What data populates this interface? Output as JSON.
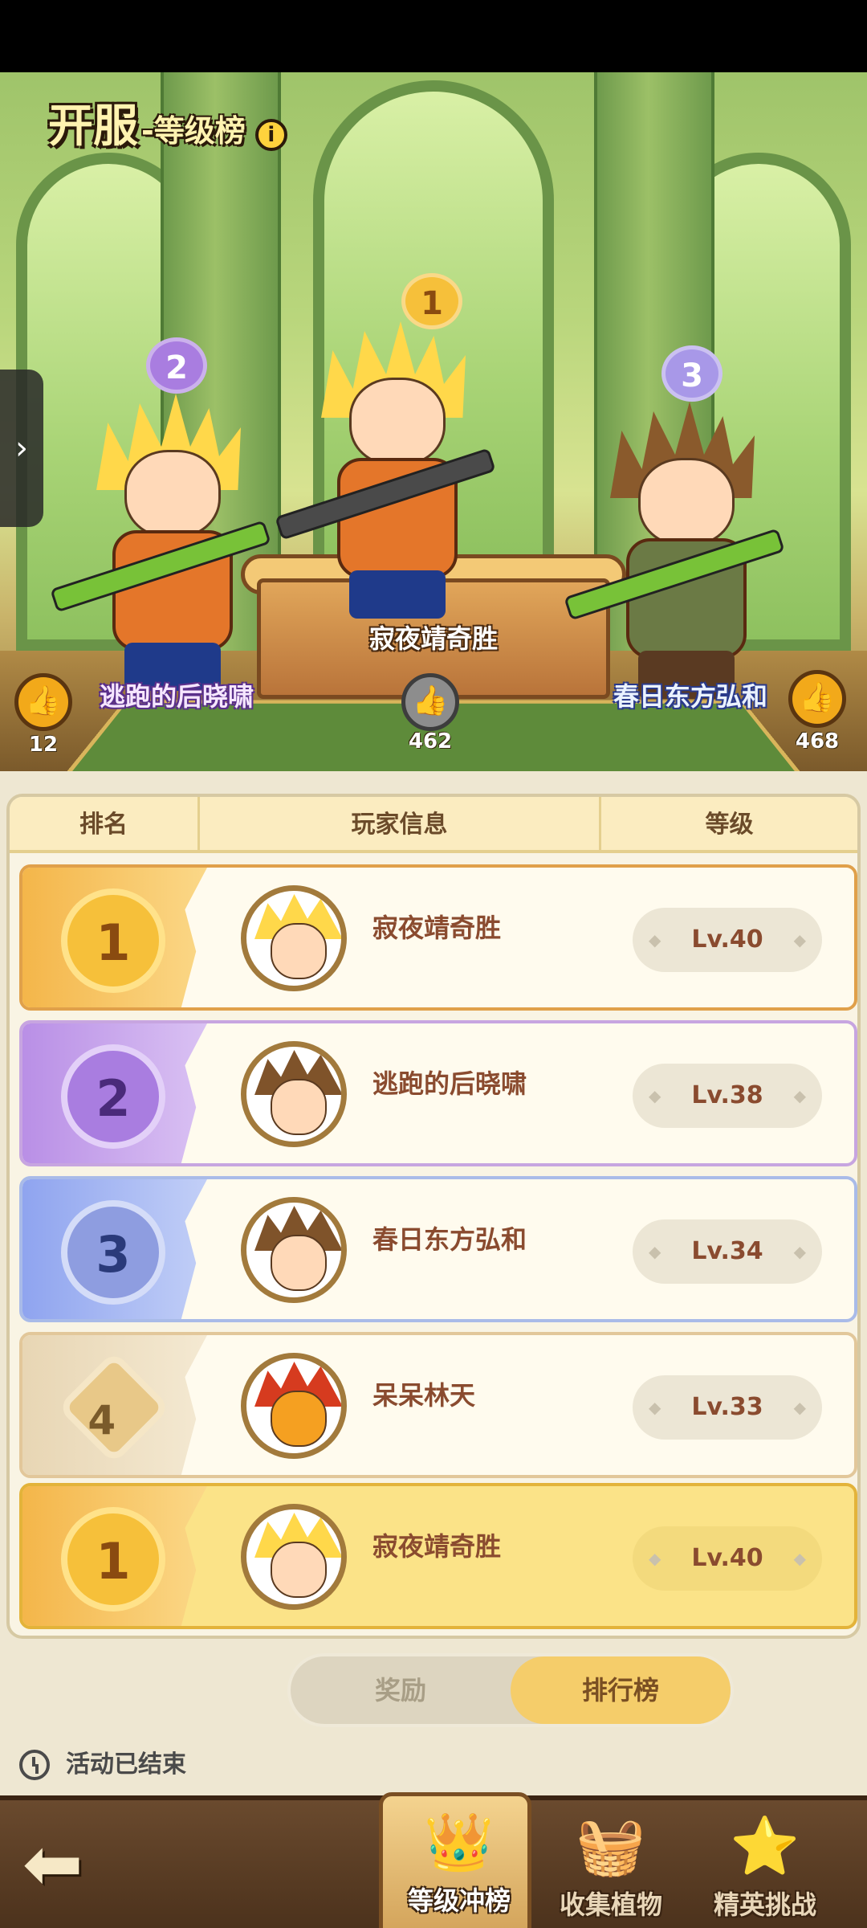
{
  "event": {
    "title_main": "开服",
    "title_sub": "-等级榜",
    "info_icon": "i"
  },
  "podium": {
    "first": {
      "rank": "1",
      "name": "寂夜靖奇胜",
      "likes": "462"
    },
    "second": {
      "rank": "2",
      "name": "逃跑的后晓啸",
      "likes": "12"
    },
    "third": {
      "rank": "3",
      "name": "春日东方弘和",
      "likes": "468"
    }
  },
  "table": {
    "headers": [
      "排名",
      "玩家信息",
      "等级"
    ],
    "rows": [
      {
        "rank": "1",
        "name": "寂夜靖奇胜",
        "level": "Lv.40"
      },
      {
        "rank": "2",
        "name": "逃跑的后晓啸",
        "level": "Lv.38"
      },
      {
        "rank": "3",
        "name": "春日东方弘和",
        "level": "Lv.34"
      },
      {
        "rank": "4",
        "name": "呆呆林天",
        "level": "Lv.33"
      }
    ],
    "my_row": {
      "rank": "1",
      "name": "寂夜靖奇胜",
      "level": "Lv.40"
    }
  },
  "toggle": {
    "rewards": "奖励",
    "ranking": "排行榜",
    "active": "ranking"
  },
  "status": {
    "text": "活动已结束"
  },
  "nav": {
    "back_icon": "arrow-left-icon",
    "tabs": [
      {
        "label": "等级冲榜",
        "icon": "crown-icon",
        "active": true
      },
      {
        "label": "收集植物",
        "icon": "plant-basket-icon",
        "active": false
      },
      {
        "label": "精英挑战",
        "icon": "star-badge-icon",
        "active": false
      }
    ]
  },
  "colors": {
    "gold": "#f6c03a",
    "purple": "#a97de0",
    "blue": "#8e9de0",
    "like_orange": "#f2a91a",
    "name_brown": "#8a4b2f"
  }
}
